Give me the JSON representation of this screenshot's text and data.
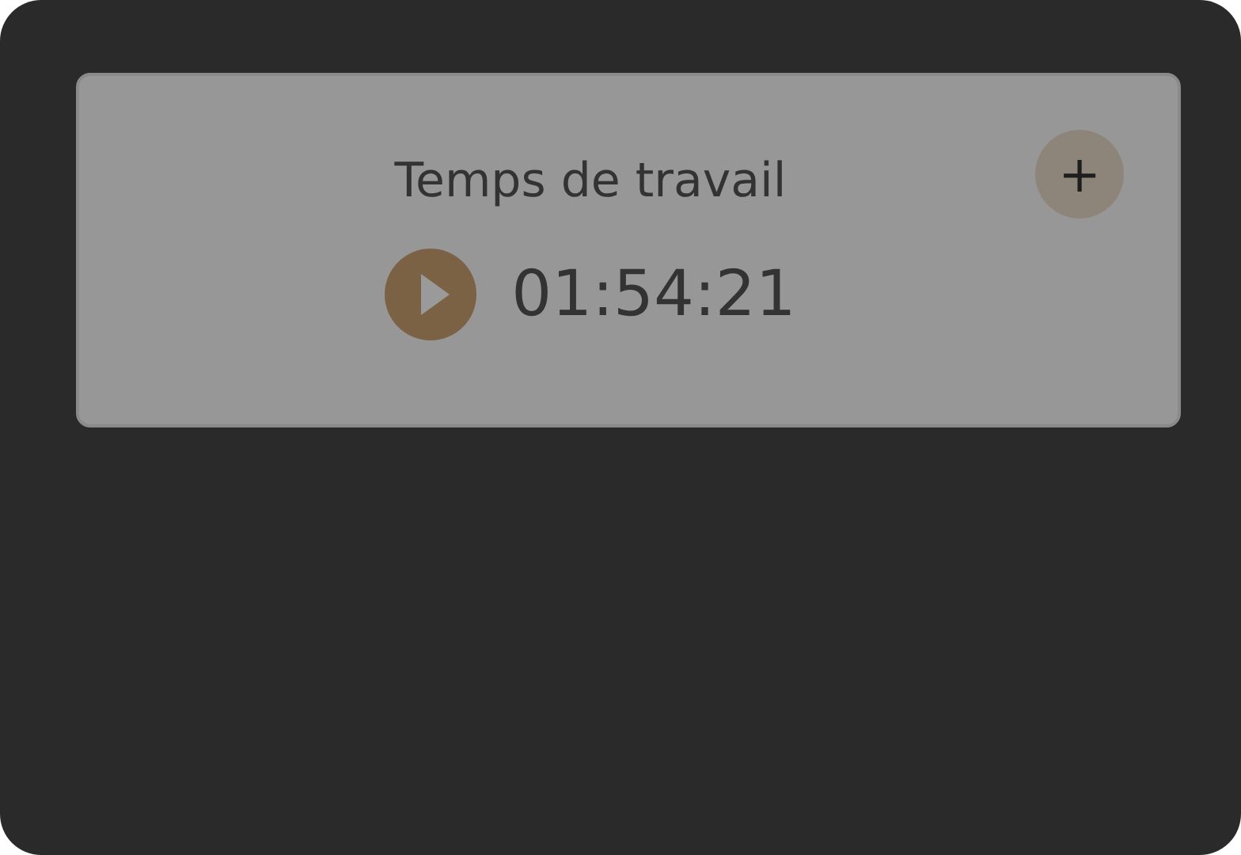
{
  "card": {
    "title": "Temps de travail",
    "add_button": "+",
    "timer": {
      "time": "01:54:21",
      "running": false
    }
  }
}
